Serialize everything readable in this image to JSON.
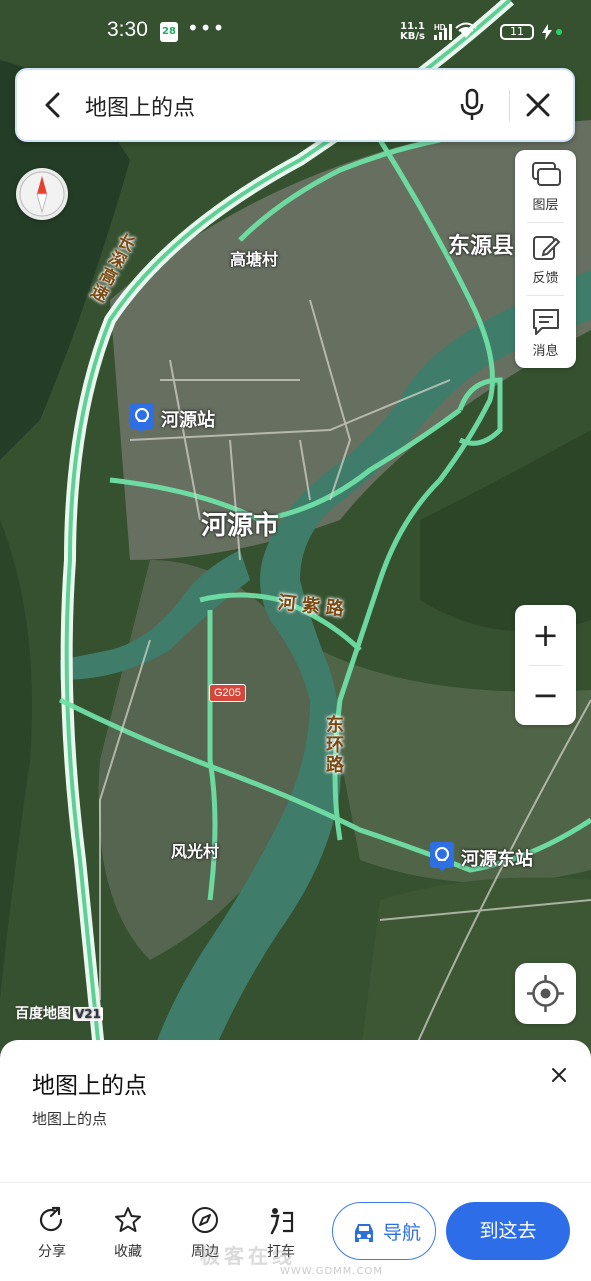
{
  "status_bar": {
    "time": "3:30",
    "calendar_day": "28",
    "more": "•••",
    "net_speed": "11.1",
    "net_unit": "KB/s",
    "hd": "HD",
    "battery": "11"
  },
  "search": {
    "query": "地图上的点",
    "back_icon": "back-arrow-icon",
    "voice_icon": "microphone-icon",
    "close_icon": "close-icon"
  },
  "map": {
    "place_labels": {
      "gaotang": "高塘村",
      "dongyuan": "东源县",
      "heyuan_city": "河源市",
      "fengguang": "风光村"
    },
    "stations": {
      "heyuan_station": "河源站",
      "heyuan_east": "河源东站"
    },
    "road_labels": {
      "changshen": "长深高速",
      "hezi": "河紫路",
      "donghuan": "东环路",
      "g205": "G205"
    },
    "colors": {
      "road_main": "#6fe0a6",
      "road_highway": "#e8f8ee",
      "water": "#3f7d6a",
      "station": "#2f6fe6"
    }
  },
  "right_panel": {
    "layers": "图层",
    "feedback": "反馈",
    "messages": "消息"
  },
  "zoom": {
    "in": "+",
    "out": "−"
  },
  "map_watermark": {
    "brand": "百度地图",
    "version": "V21"
  },
  "sheet": {
    "title": "地图上的点",
    "subtitle": "地图上的点",
    "actions": {
      "share": "分享",
      "favorite": "收藏",
      "nearby": "周边",
      "taxi": "打车"
    },
    "navigate": "导航",
    "go_here": "到这去"
  },
  "watermark": {
    "main": "极客在线",
    "url": "WWW.GDMM.COM"
  }
}
